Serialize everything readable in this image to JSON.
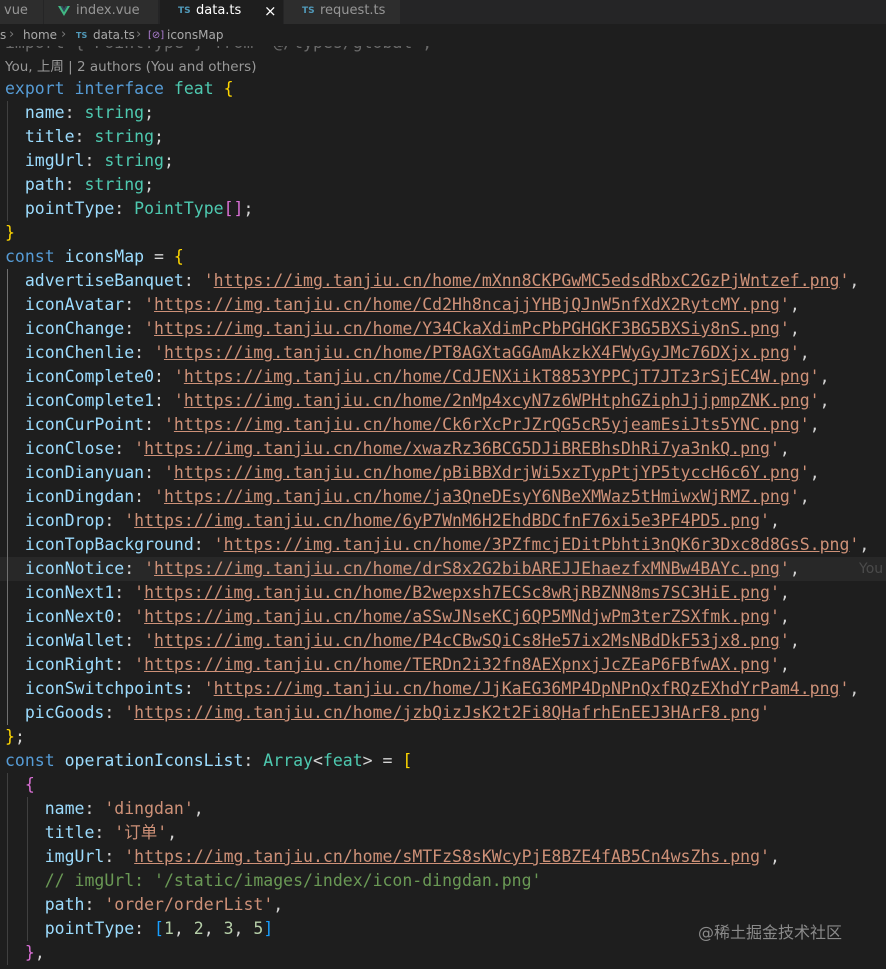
{
  "tabs": [
    {
      "label": "vue",
      "icon": "vue-icon",
      "active": false
    },
    {
      "label": "index.vue",
      "icon": "vue-icon",
      "active": false
    },
    {
      "label": "data.ts",
      "icon": "ts-icon",
      "active": true
    },
    {
      "label": "request.ts",
      "icon": "ts-icon",
      "active": false
    }
  ],
  "tab_icon_text": "TS",
  "close_glyph": "×",
  "breadcrumb": {
    "items": [
      "s",
      "home",
      "data.ts",
      "iconsMap"
    ],
    "separator": "›",
    "file_icon": "TS",
    "symbol_icon": "[⊘]"
  },
  "ghost_import": "import { PointType } from '@/types/global';",
  "blame": "You, 上周 | 2 authors (You and others)",
  "inline_blame": "You",
  "watermark": "@稀土掘金技术社区",
  "colors": {
    "background": "#1e1e1e",
    "keyword": "#569cd6",
    "type": "#4ec9b0",
    "property": "#9cdcfe",
    "string": "#ce9178",
    "number": "#b5cea8",
    "comment": "#6a9955",
    "bracket_1": "#ffd700",
    "bracket_2": "#da70d6",
    "bracket_3": "#179fff"
  },
  "code": {
    "interface_keyword_export": "export",
    "interface_keyword": "interface",
    "interface_name": "feat",
    "fields": [
      {
        "name": "name",
        "type": "string"
      },
      {
        "name": "title",
        "type": "string"
      },
      {
        "name": "imgUrl",
        "type": "string"
      },
      {
        "name": "path",
        "type": "string"
      },
      {
        "name": "pointType",
        "type": "PointType",
        "array": "[]"
      }
    ],
    "const_keyword": "const",
    "icons_map_name": "iconsMap",
    "icons": [
      {
        "key": "advertiseBanquet",
        "url": "https://img.tanjiu.cn/home/mXnn8CKPGwMC5edsdRbxC2GzPjWntzef.png"
      },
      {
        "key": "iconAvatar",
        "url": "https://img.tanjiu.cn/home/Cd2Hh8ncajjYHBjQJnW5nfXdX2RytcMY.png"
      },
      {
        "key": "iconChange",
        "url": "https://img.tanjiu.cn/home/Y34CkaXdimPcPbPGHGKF3BG5BXSiy8nS.png"
      },
      {
        "key": "iconChenlie",
        "url": "https://img.tanjiu.cn/home/PT8AGXtaGGAmAkzkX4FWyGyJMc76DXjx.png"
      },
      {
        "key": "iconComplete0",
        "url": "https://img.tanjiu.cn/home/CdJENXiikT8853YPPCjT7JTz3rSjEC4W.png"
      },
      {
        "key": "iconComplete1",
        "url": "https://img.tanjiu.cn/home/2nMp4xcyN7z6WPHtphGZiphJjjpmpZNK.png"
      },
      {
        "key": "iconCurPoint",
        "url": "https://img.tanjiu.cn/home/Ck6rXcPrJZrQG5cR5yjeamEsiJts5YNC.png"
      },
      {
        "key": "iconClose",
        "url": "https://img.tanjiu.cn/home/xwazRz36BCG5DJiBREBhsDhRi7ya3nkQ.png"
      },
      {
        "key": "iconDianyuan",
        "url": "https://img.tanjiu.cn/home/pBiBBXdrjWi5xzTypPtjYP5tyccH6c6Y.png"
      },
      {
        "key": "iconDingdan",
        "url": "https://img.tanjiu.cn/home/ja3QneDEsyY6NBeXMWaz5tHmiwxWjRMZ.png"
      },
      {
        "key": "iconDrop",
        "url": "https://img.tanjiu.cn/home/6yP7WnM6H2EhdBDCfnF76xi5e3PF4PD5.png"
      },
      {
        "key": "iconTopBackground",
        "url": "https://img.tanjiu.cn/home/3PZfmcjEDitPbhti3nQK6r3Dxc8d8GsS.png"
      },
      {
        "key": "iconNotice",
        "url": "https://img.tanjiu.cn/home/drS8x2G2bibAREJJEhaezfxMNBw4BAYc.png"
      },
      {
        "key": "iconNext1",
        "url": "https://img.tanjiu.cn/home/B2wepxsh7ECSc8wRjRBZNN8ms7SC3HiE.png"
      },
      {
        "key": "iconNext0",
        "url": "https://img.tanjiu.cn/home/aSSwJNseKCj6QP5MNdjwPm3terZSXfmk.png"
      },
      {
        "key": "iconWallet",
        "url": "https://img.tanjiu.cn/home/P4cCBwSQiCs8He57ix2MsNBdDkF53jx8.png"
      },
      {
        "key": "iconRight",
        "url": "https://img.tanjiu.cn/home/TERDn2i32fn8AEXpnxjJcZEaP6FBfwAX.png"
      },
      {
        "key": "iconSwitchpoints",
        "url": "https://img.tanjiu.cn/home/JjKaEG36MP4DpNPnQxfRQzEXhdYrPam4.png"
      },
      {
        "key": "picGoods",
        "url": "https://img.tanjiu.cn/home/jzbQizJsK2t2Fi8QHafrhEnEEJ3HArF8.png"
      }
    ],
    "operation_list_name": "operationIconsList",
    "array_type": "Array",
    "operation_item": {
      "name": "dingdan",
      "title": "订单",
      "imgUrl": "https://img.tanjiu.cn/home/sMTFzS8sKWcyPjE8BZE4fAB5Cn4wsZhs.png",
      "comment": "// imgUrl: '/static/images/index/icon-dingdan.png'",
      "path": "order/orderList",
      "pointType": [
        1,
        2,
        3,
        5
      ]
    }
  }
}
